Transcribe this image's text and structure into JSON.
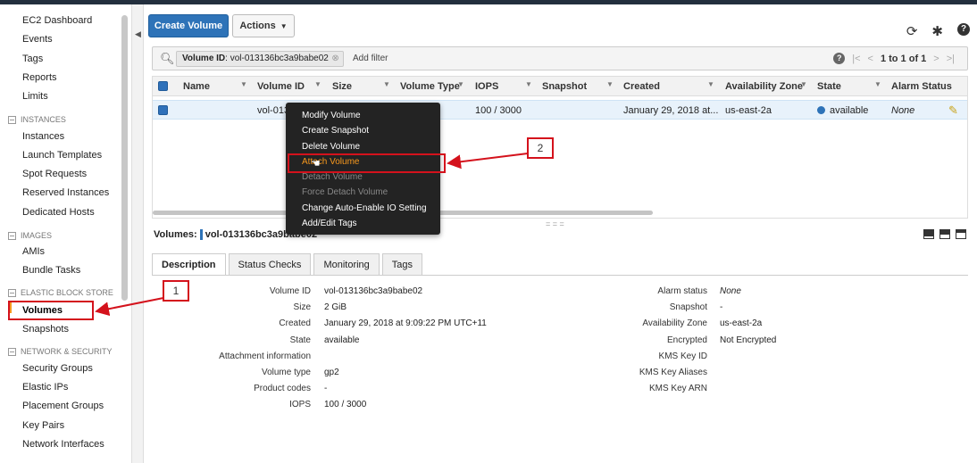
{
  "sidebar": {
    "items": [
      "EC2 Dashboard",
      "Events",
      "Tags",
      "Reports",
      "Limits"
    ],
    "instances_head": "INSTANCES",
    "instances": [
      "Instances",
      "Launch Templates",
      "Spot Requests",
      "Reserved Instances",
      "Dedicated Hosts"
    ],
    "images_head": "IMAGES",
    "images": [
      "AMIs",
      "Bundle Tasks"
    ],
    "ebs_head": "ELASTIC BLOCK STORE",
    "ebs": [
      "Volumes",
      "Snapshots"
    ],
    "net_head": "NETWORK & SECURITY",
    "net": [
      "Security Groups",
      "Elastic IPs",
      "Placement Groups",
      "Key Pairs",
      "Network Interfaces"
    ]
  },
  "toolbar": {
    "create_label": "Create Volume",
    "actions_label": "Actions"
  },
  "filter": {
    "chip_key": "Volume ID",
    "chip_value": ": vol-013136bc3a9babe02",
    "add_filter": "Add filter"
  },
  "pager": {
    "text": "1 to 1 of 1"
  },
  "table": {
    "columns": [
      "Name",
      "Volume ID",
      "Size",
      "Volume Type",
      "IOPS",
      "Snapshot",
      "Created",
      "Availability Zone",
      "State",
      "Alarm Status"
    ],
    "row": {
      "name": "",
      "volume_id": "vol-0131",
      "size": "",
      "type": "",
      "iops": "100 / 3000",
      "snapshot": "",
      "created": "January 29, 2018 at...",
      "az": "us-east-2a",
      "state": "available",
      "alarm": "None"
    }
  },
  "context_menu": {
    "items": [
      "Modify Volume",
      "Create Snapshot",
      "Delete Volume",
      "Attach Volume",
      "Detach Volume",
      "Force Detach Volume",
      "Change Auto-Enable IO Setting",
      "Add/Edit Tags"
    ]
  },
  "detail": {
    "title_prefix": "Volumes:",
    "title_value": "vol-013136bc3a9babe02",
    "tabs": [
      "Description",
      "Status Checks",
      "Monitoring",
      "Tags"
    ],
    "left": [
      {
        "label": "Volume ID",
        "value": "vol-013136bc3a9babe02"
      },
      {
        "label": "Size",
        "value": "2 GiB"
      },
      {
        "label": "Created",
        "value": "January 29, 2018 at 9:09:22 PM UTC+11"
      },
      {
        "label": "State",
        "value": "available"
      },
      {
        "label": "Attachment information",
        "value": ""
      },
      {
        "label": "Volume type",
        "value": "gp2"
      },
      {
        "label": "Product codes",
        "value": "-"
      },
      {
        "label": "IOPS",
        "value": "100 / 3000"
      }
    ],
    "right": [
      {
        "label": "Alarm status",
        "value": "None"
      },
      {
        "label": "Snapshot",
        "value": "-"
      },
      {
        "label": "Availability Zone",
        "value": "us-east-2a"
      },
      {
        "label": "Encrypted",
        "value": "Not Encrypted"
      },
      {
        "label": "KMS Key ID",
        "value": ""
      },
      {
        "label": "KMS Key Aliases",
        "value": ""
      },
      {
        "label": "KMS Key ARN",
        "value": ""
      }
    ]
  },
  "annotations": {
    "one": "1",
    "two": "2"
  },
  "colors": {
    "accent": "#2e73b8",
    "highlight": "#f7981d",
    "annotation": "#d4121c"
  }
}
